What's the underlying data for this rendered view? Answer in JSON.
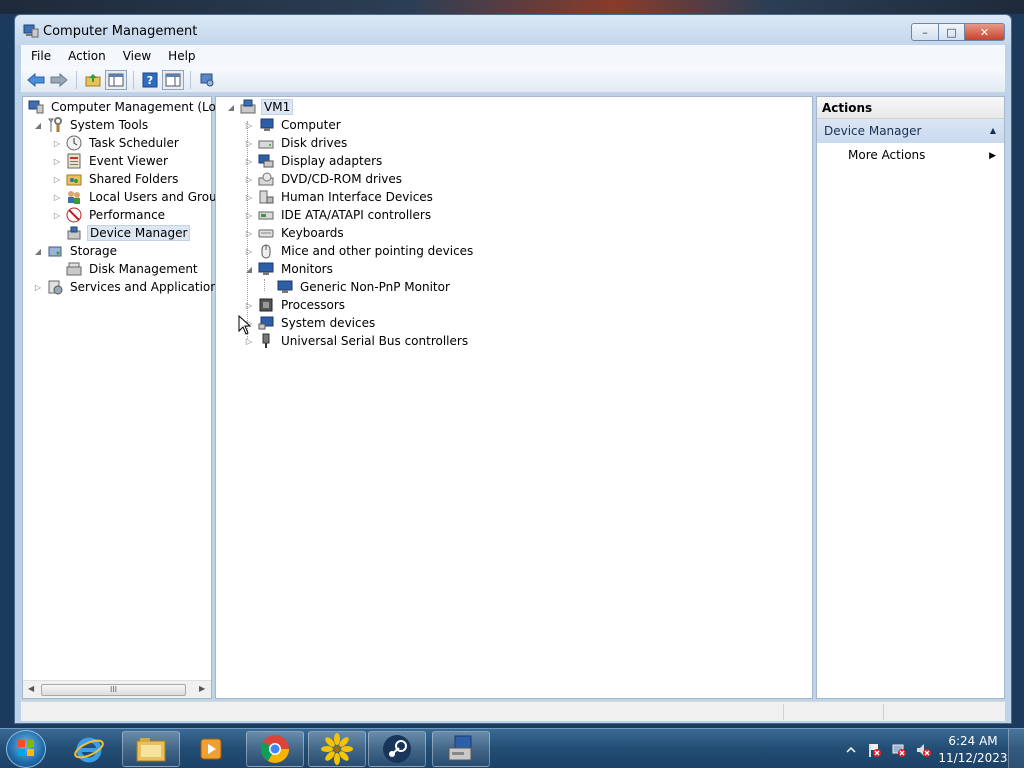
{
  "window": {
    "title": "Computer Management",
    "controls": {
      "minimize": "–",
      "maximize": "□",
      "close": "✕"
    }
  },
  "menubar": [
    "File",
    "Action",
    "View",
    "Help"
  ],
  "toolbar": {
    "icons": [
      "back-arrow-icon",
      "forward-arrow-icon",
      "up-folder-icon",
      "show-hide-console-tree-icon",
      "help-icon",
      "show-hide-action-pane-icon",
      "properties-icon"
    ]
  },
  "left_tree": {
    "root": "Computer Management (Local",
    "system_tools": "System Tools",
    "task_scheduler": "Task Scheduler",
    "event_viewer": "Event Viewer",
    "shared_folders": "Shared Folders",
    "local_users": "Local Users and Groups",
    "performance": "Performance",
    "device_manager": "Device Manager",
    "storage": "Storage",
    "disk_management": "Disk Management",
    "services": "Services and Applications",
    "scroll_thumb": "III"
  },
  "device_tree": {
    "root": "VM1",
    "categories": [
      "Computer",
      "Disk drives",
      "Display adapters",
      "DVD/CD-ROM drives",
      "Human Interface Devices",
      "IDE ATA/ATAPI controllers",
      "Keyboards",
      "Mice and other pointing devices",
      "Monitors",
      "Processors",
      "System devices",
      "Universal Serial Bus controllers"
    ],
    "monitor_child": "Generic Non-PnP Monitor"
  },
  "actions": {
    "header": "Actions",
    "section": "Device Manager",
    "more_actions": "More Actions"
  },
  "taskbar": {
    "apps": [
      "internet-explorer-icon",
      "file-explorer-icon",
      "media-player-icon",
      "chrome-icon",
      "sunflower-app-icon",
      "steam-icon",
      "computer-management-icon"
    ],
    "clock_time": "6:24 AM",
    "clock_date": "11/12/2023"
  }
}
